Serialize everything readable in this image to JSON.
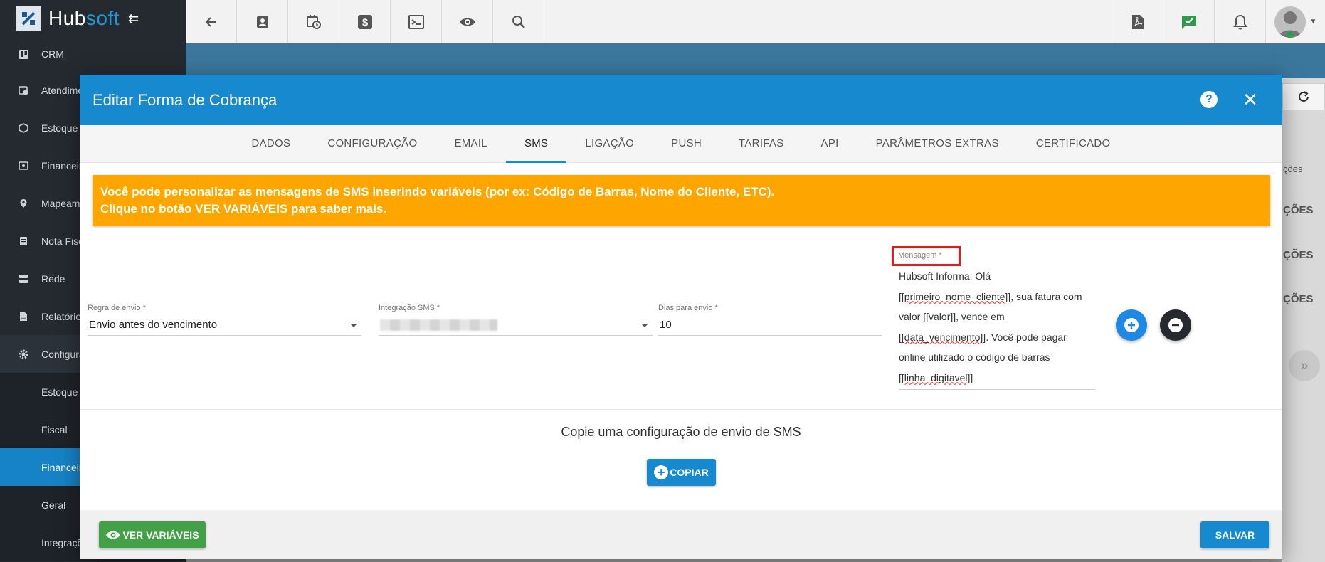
{
  "app": {
    "brand_main": "Hub",
    "brand_accent": "soft"
  },
  "sidebar": {
    "items": [
      {
        "label": "CRM",
        "icon": "trello-icon"
      },
      {
        "label": "Atendimento",
        "icon": "calendar-clock-icon"
      },
      {
        "label": "Estoque",
        "icon": "cube-icon"
      },
      {
        "label": "Financeiro",
        "icon": "money-icon"
      },
      {
        "label": "Mapeamento",
        "icon": "map-marker-icon"
      },
      {
        "label": "Nota Fiscal",
        "icon": "document-icon"
      },
      {
        "label": "Rede",
        "icon": "server-icon"
      },
      {
        "label": "Relatórios",
        "icon": "report-icon"
      },
      {
        "label": "Configurações",
        "icon": "gear-icon"
      }
    ],
    "sub_items": [
      {
        "label": "Estoque"
      },
      {
        "label": "Fiscal"
      },
      {
        "label": "Financeiro"
      },
      {
        "label": "Geral"
      },
      {
        "label": "Integrações"
      }
    ]
  },
  "background": {
    "labels": [
      "ções",
      "ÇÕES",
      "ÇÕES",
      "ÇÕES"
    ]
  },
  "modal": {
    "title": "Editar Forma de Cobrança",
    "tabs": [
      {
        "label": "DADOS"
      },
      {
        "label": "CONFIGURAÇÃO"
      },
      {
        "label": "EMAIL"
      },
      {
        "label": "SMS"
      },
      {
        "label": "LIGAÇÃO"
      },
      {
        "label": "PUSH"
      },
      {
        "label": "TARIFAS"
      },
      {
        "label": "API"
      },
      {
        "label": "PARÂMETROS EXTRAS"
      },
      {
        "label": "CERTIFICADO"
      }
    ],
    "active_tab": "SMS",
    "alert": {
      "line1": "Você pode personalizar as mensagens de SMS inserindo variáveis (por ex: Código de Barras, Nome do Cliente, ETC).",
      "line2": "Clique no botão VER VARIÁVEIS para saber mais."
    },
    "fields": {
      "regra": {
        "label": "Regra de envio *",
        "value": "Envio antes do vencimento"
      },
      "integracao": {
        "label": "Integração SMS *",
        "value": ""
      },
      "dias": {
        "label": "Dias para envio *",
        "value": "10"
      },
      "mensagem": {
        "label": "Mensagem *",
        "parts": [
          "Hubsoft Informa: Olá ",
          "[[primeiro_nome_cliente]]",
          ", sua fatura com valor [[valor]], vence em ",
          "[[data_vencimento]]",
          ". Você pode pagar online utilizado o código de barras ",
          "[[linha_digitavel]]"
        ]
      }
    },
    "copy_text": "Copie uma configuração de envio de SMS",
    "copy_button": "COPIAR",
    "vars_button": "VER VARIÁVEIS",
    "save_button": "SALVAR"
  },
  "colors": {
    "primary": "#1689cf",
    "alert": "#ffa500",
    "success": "#43a047",
    "sidebar": "#252a31"
  }
}
